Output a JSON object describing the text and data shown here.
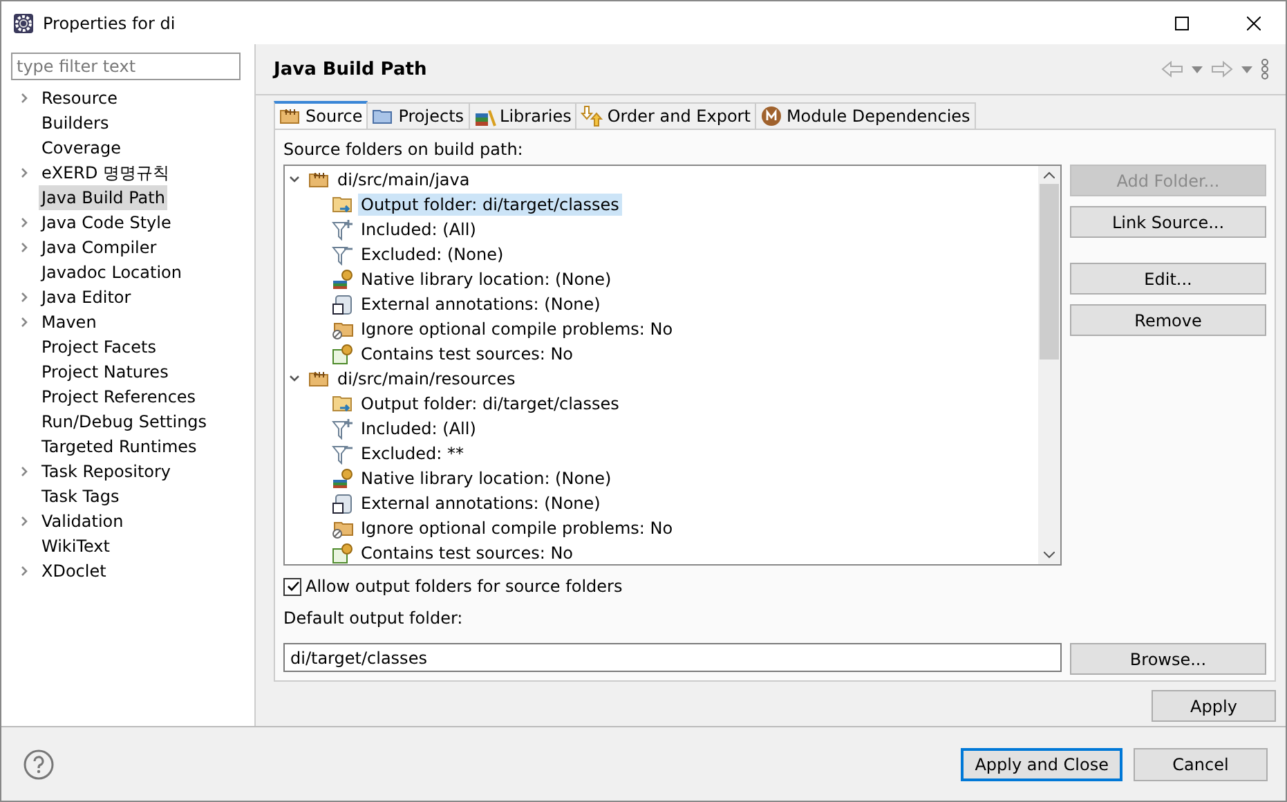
{
  "window": {
    "title": "Properties for di"
  },
  "sidebar": {
    "filter": {
      "placeholder": "type filter text"
    },
    "items": [
      {
        "label": "Resource",
        "expandable": true,
        "selected": false
      },
      {
        "label": "Builders",
        "expandable": false,
        "selected": false
      },
      {
        "label": "Coverage",
        "expandable": false,
        "selected": false
      },
      {
        "label": "eXERD 명명규칙",
        "expandable": true,
        "selected": false
      },
      {
        "label": "Java Build Path",
        "expandable": false,
        "selected": true
      },
      {
        "label": "Java Code Style",
        "expandable": true,
        "selected": false
      },
      {
        "label": "Java Compiler",
        "expandable": true,
        "selected": false
      },
      {
        "label": "Javadoc Location",
        "expandable": false,
        "selected": false
      },
      {
        "label": "Java Editor",
        "expandable": true,
        "selected": false
      },
      {
        "label": "Maven",
        "expandable": true,
        "selected": false
      },
      {
        "label": "Project Facets",
        "expandable": false,
        "selected": false
      },
      {
        "label": "Project Natures",
        "expandable": false,
        "selected": false
      },
      {
        "label": "Project References",
        "expandable": false,
        "selected": false
      },
      {
        "label": "Run/Debug Settings",
        "expandable": false,
        "selected": false
      },
      {
        "label": "Targeted Runtimes",
        "expandable": false,
        "selected": false
      },
      {
        "label": "Task Repository",
        "expandable": true,
        "selected": false
      },
      {
        "label": "Task Tags",
        "expandable": false,
        "selected": false
      },
      {
        "label": "Validation",
        "expandable": true,
        "selected": false
      },
      {
        "label": "WikiText",
        "expandable": false,
        "selected": false
      },
      {
        "label": "XDoclet",
        "expandable": true,
        "selected": false
      }
    ]
  },
  "page": {
    "title": "Java Build Path"
  },
  "tabs": [
    {
      "label": "Source",
      "kind": "source",
      "selected": true
    },
    {
      "label": "Projects",
      "kind": "projects",
      "selected": false
    },
    {
      "label": "Libraries",
      "kind": "libraries",
      "selected": false
    },
    {
      "label": "Order and Export",
      "kind": "order",
      "selected": false
    },
    {
      "label": "Module Dependencies",
      "kind": "module",
      "selected": false
    }
  ],
  "source_label": "Source folders on build path:",
  "tree": [
    {
      "label": "di/src/main/java",
      "expanded": true,
      "children": [
        {
          "label": "Output folder: di/target/classes",
          "kind": "output",
          "selected": true
        },
        {
          "label": "Included: (All)",
          "kind": "included",
          "selected": false
        },
        {
          "label": "Excluded: (None)",
          "kind": "excluded",
          "selected": false
        },
        {
          "label": "Native library location: (None)",
          "kind": "native",
          "selected": false
        },
        {
          "label": "External annotations: (None)",
          "kind": "annotations",
          "selected": false
        },
        {
          "label": "Ignore optional compile problems: No",
          "kind": "ignore",
          "selected": false
        },
        {
          "label": "Contains test sources: No",
          "kind": "test",
          "selected": false
        }
      ]
    },
    {
      "label": "di/src/main/resources",
      "expanded": true,
      "children": [
        {
          "label": "Output folder: di/target/classes",
          "kind": "output",
          "selected": false
        },
        {
          "label": "Included: (All)",
          "kind": "included",
          "selected": false
        },
        {
          "label": "Excluded: **",
          "kind": "excluded",
          "selected": false
        },
        {
          "label": "Native library location: (None)",
          "kind": "native",
          "selected": false
        },
        {
          "label": "External annotations: (None)",
          "kind": "annotations",
          "selected": false
        },
        {
          "label": "Ignore optional compile problems: No",
          "kind": "ignore",
          "selected": false
        },
        {
          "label": "Contains test sources: No",
          "kind": "test",
          "selected": false
        }
      ]
    }
  ],
  "side_buttons": [
    {
      "label": "Add Folder...",
      "disabled": true
    },
    {
      "label": "Link Source...",
      "disabled": false
    },
    {
      "label": "Edit...",
      "disabled": false
    },
    {
      "label": "Remove",
      "disabled": false
    }
  ],
  "allow_output": {
    "label": "Allow output folders for source folders",
    "checked": true
  },
  "default_output": {
    "label": "Default output folder:",
    "value": "di/target/classes",
    "browse": "Browse..."
  },
  "apply": "Apply",
  "footer": {
    "apply_close": "Apply and Close",
    "cancel": "Cancel"
  }
}
